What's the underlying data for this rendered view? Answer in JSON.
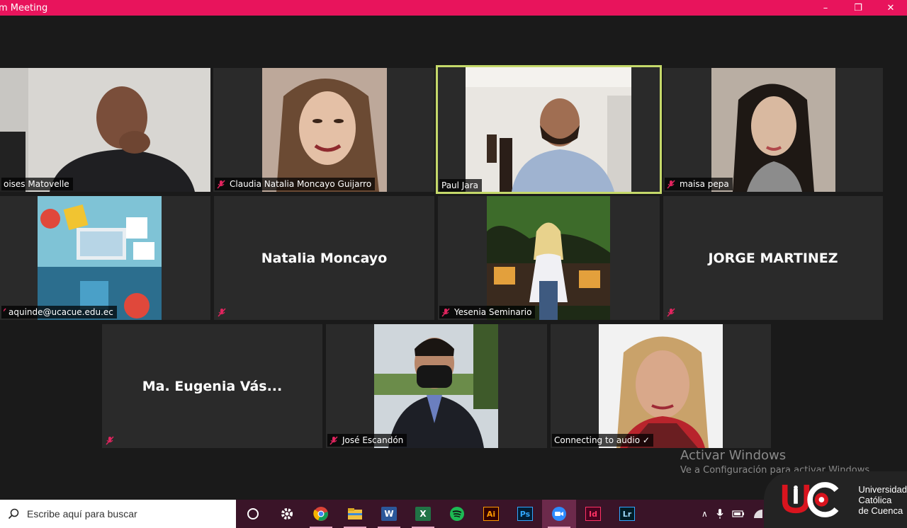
{
  "window": {
    "title": "m Meeting",
    "controls": {
      "minimize": "–",
      "restore": "❐",
      "close": "✕"
    }
  },
  "participants": [
    {
      "name": "Moises Matovelle",
      "display": "oises Matovelle",
      "muted": false,
      "video": true
    },
    {
      "name": "Claudia Natalia Moncayo Guijarro",
      "muted": true,
      "video": true
    },
    {
      "name": "Paul Jara",
      "muted": false,
      "video": true,
      "active_speaker": true
    },
    {
      "name": "maisa pepa",
      "muted": true,
      "video": true
    },
    {
      "name": "aquinde@ucacue.edu.ec",
      "muted": true,
      "video": true
    },
    {
      "name": "Natalia Moncayo",
      "muted": true,
      "video": false
    },
    {
      "name": "Yesenia Seminario",
      "muted": true,
      "video": true
    },
    {
      "name": "JORGE MARTINEZ",
      "muted": true,
      "video": false
    },
    {
      "name": "Ma. Eugenia Vás...",
      "muted": true,
      "video": false
    },
    {
      "name": "José Escandón",
      "muted": true,
      "video": true
    },
    {
      "name": "Connecting to audio ✓",
      "muted": false,
      "video": true
    }
  ],
  "watermark": {
    "line1": "Activar Windows",
    "line2": "Ve a Configuración para activar Windows."
  },
  "taskbar": {
    "search_placeholder": "Escribe aquí para buscar",
    "apps": [
      "task-view",
      "settings",
      "chrome",
      "file-explorer",
      "word",
      "excel",
      "spotify",
      "illustrator",
      "photoshop",
      "zoom",
      "indesign",
      "lightroom"
    ],
    "app_labels": {
      "illustrator": "Ai",
      "photoshop": "Ps",
      "indesign": "Id",
      "lightroom": "Lr",
      "word": "W",
      "excel": "X"
    }
  },
  "logo": {
    "line1": "Universidad",
    "line2": "Católica",
    "line3": "de Cuenca"
  },
  "colors": {
    "titlebar": "#e8145c",
    "active_speaker_border": "#c5d96a",
    "tile_bg": "#2a2a2a",
    "muted_icon": "#e0245e",
    "taskbar": "#3a1428"
  }
}
